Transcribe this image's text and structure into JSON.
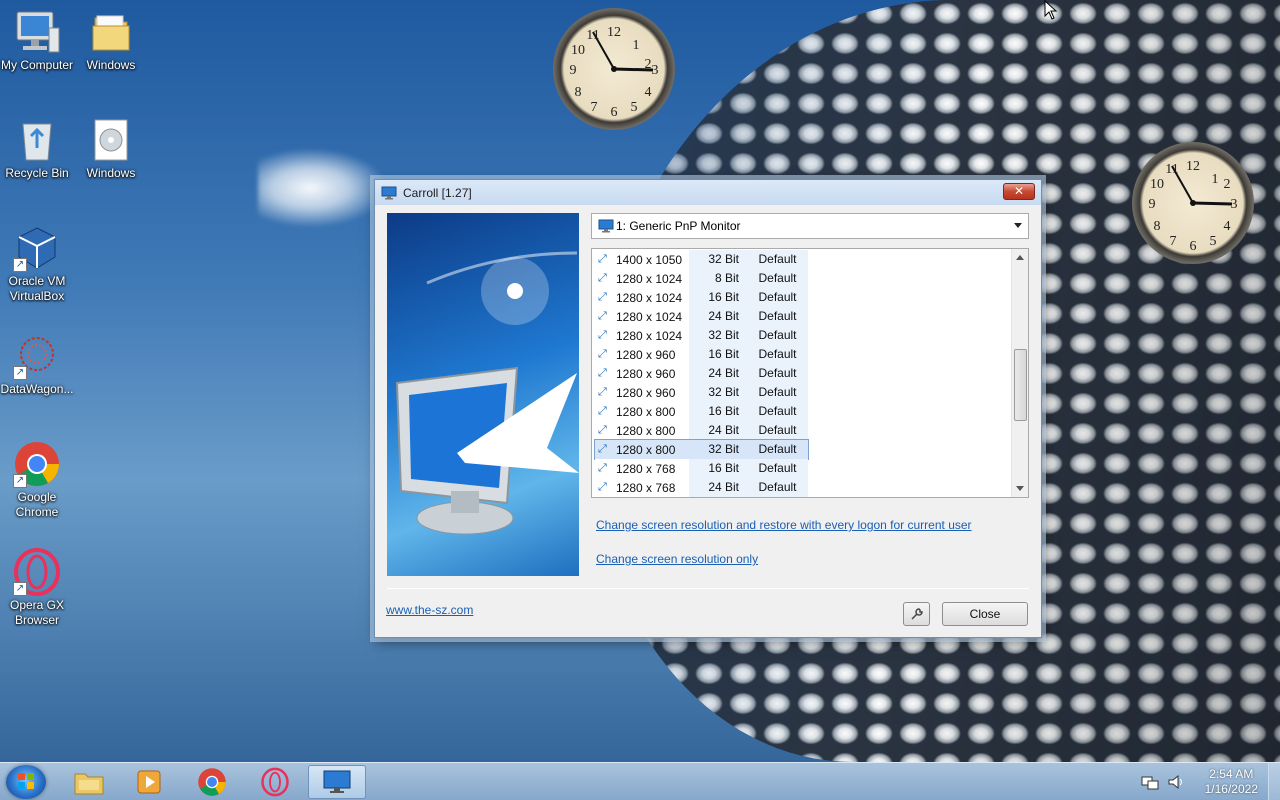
{
  "desktop": {
    "icons": [
      {
        "label": "My Computer"
      },
      {
        "label": "Windows"
      },
      {
        "label": "Recycle Bin"
      },
      {
        "label": "Windows"
      },
      {
        "label": "Oracle VM VirtualBox"
      },
      {
        "label": "DataWagon..."
      },
      {
        "label": "Google Chrome"
      },
      {
        "label": "Opera GX Browser"
      }
    ]
  },
  "dialog": {
    "title": "Carroll [1.27]",
    "monitor": "1: Generic PnP Monitor",
    "resolutions": [
      {
        "res": "1400 x 1050",
        "bits": "32 Bit",
        "freq": "Default"
      },
      {
        "res": "1280 x 1024",
        "bits": "8 Bit",
        "freq": "Default"
      },
      {
        "res": "1280 x 1024",
        "bits": "16 Bit",
        "freq": "Default"
      },
      {
        "res": "1280 x 1024",
        "bits": "24 Bit",
        "freq": "Default"
      },
      {
        "res": "1280 x 1024",
        "bits": "32 Bit",
        "freq": "Default"
      },
      {
        "res": "1280 x 960",
        "bits": "16 Bit",
        "freq": "Default"
      },
      {
        "res": "1280 x 960",
        "bits": "24 Bit",
        "freq": "Default"
      },
      {
        "res": "1280 x 960",
        "bits": "32 Bit",
        "freq": "Default"
      },
      {
        "res": "1280 x 800",
        "bits": "16 Bit",
        "freq": "Default"
      },
      {
        "res": "1280 x 800",
        "bits": "24 Bit",
        "freq": "Default"
      },
      {
        "res": "1280 x 800",
        "bits": "32 Bit",
        "freq": "Default"
      },
      {
        "res": "1280 x 768",
        "bits": "16 Bit",
        "freq": "Default"
      },
      {
        "res": "1280 x 768",
        "bits": "24 Bit",
        "freq": "Default"
      }
    ],
    "selected_row": 10,
    "link_restore": "Change screen resolution and restore with every logon for current user",
    "link_only": "Change screen resolution only",
    "website": "www.the-sz.com",
    "close_label": "Close",
    "titlebar_close_glyph": "✕"
  },
  "taskbar": {
    "time": "2:54 AM",
    "date": "1/16/2022"
  },
  "clocks": [
    {
      "hour": 3,
      "minute": 54
    },
    {
      "hour": 3,
      "minute": 54
    }
  ]
}
